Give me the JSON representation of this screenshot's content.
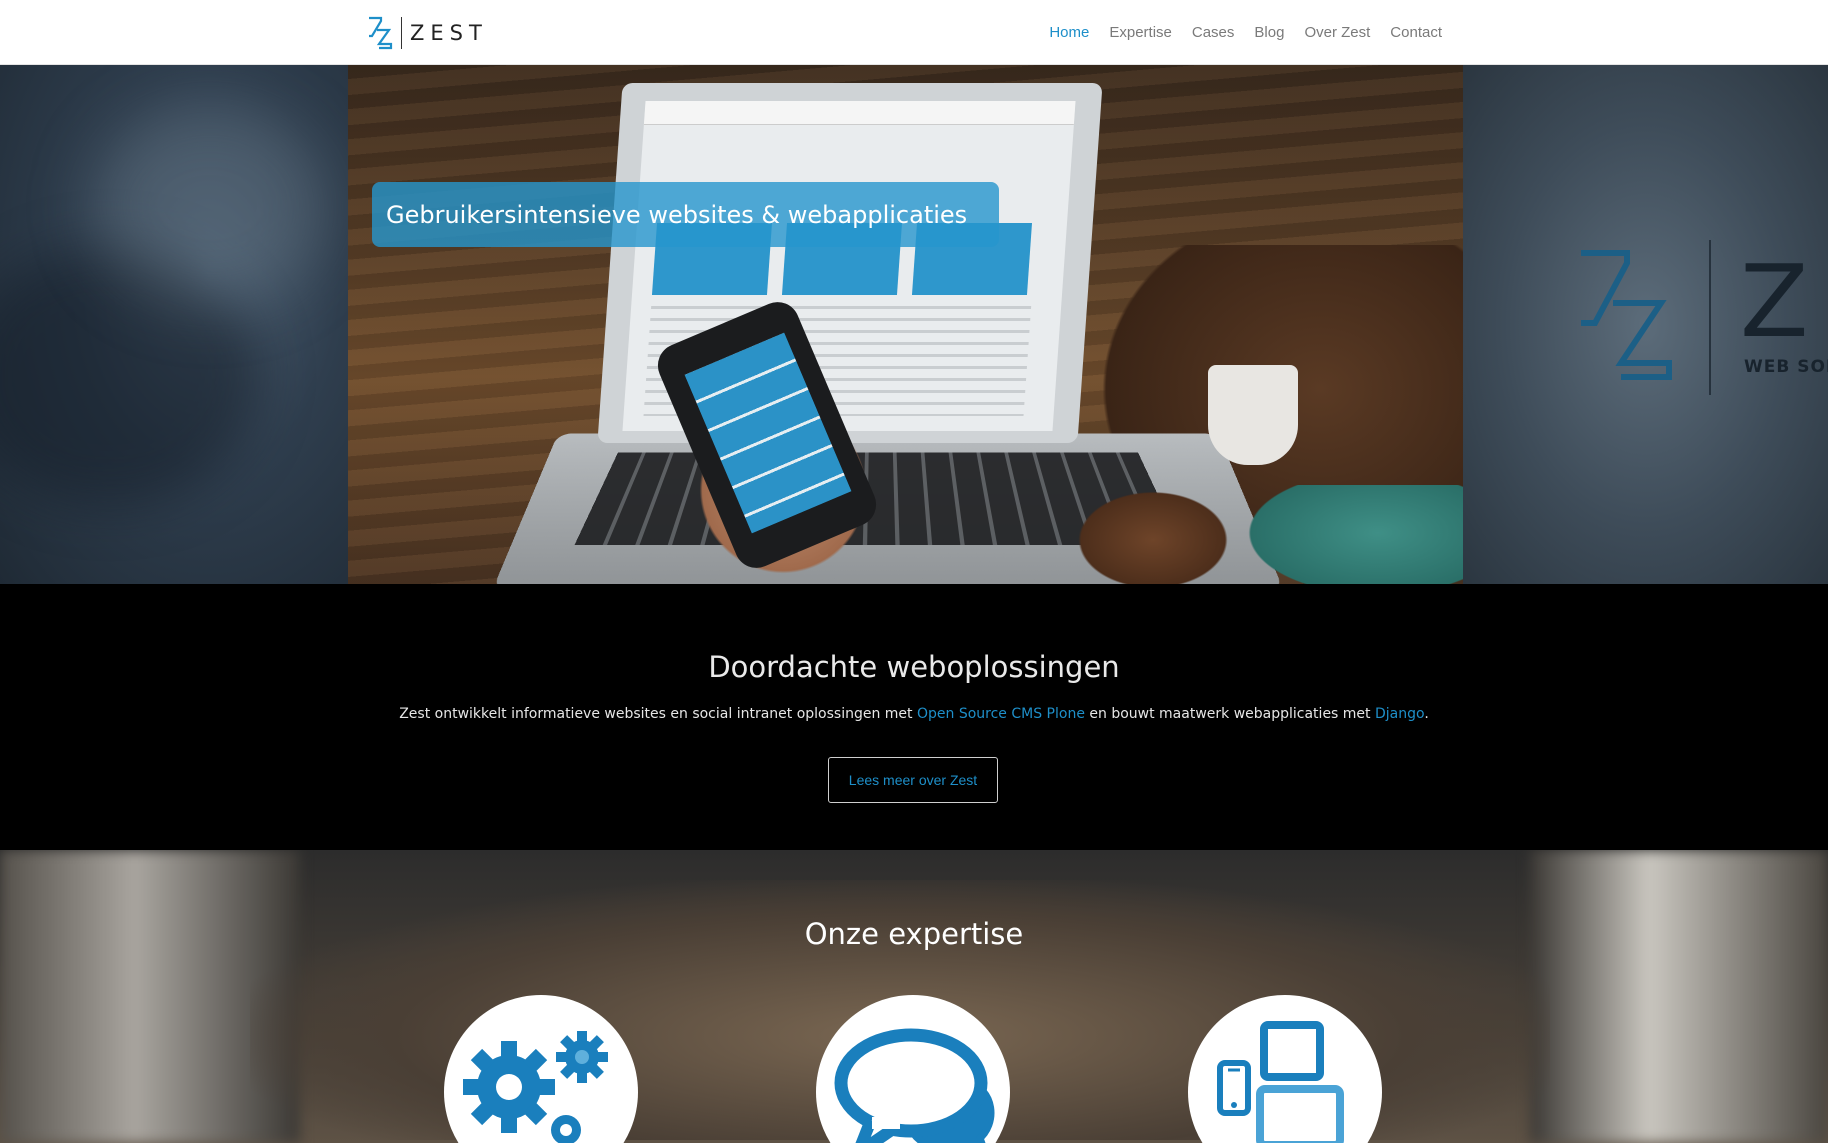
{
  "header": {
    "logo_text": "ZEST",
    "nav": [
      {
        "label": "Home",
        "active": true
      },
      {
        "label": "Expertise",
        "active": false
      },
      {
        "label": "Cases",
        "active": false
      },
      {
        "label": "Blog",
        "active": false
      },
      {
        "label": "Over Zest",
        "active": false
      },
      {
        "label": "Contact",
        "active": false
      }
    ]
  },
  "hero": {
    "caption": "Gebruikersintensieve websites & webapplicaties",
    "slides_total": 3,
    "active_slide": 2,
    "side_logo_letter": "Z",
    "side_logo_subtext": "WEB SOLU"
  },
  "intro": {
    "title": "Doordachte weboplossingen",
    "text_before": "Zest ontwikkelt informatieve websites en social intranet oplossingen met ",
    "link1": "Open Source CMS Plone",
    "text_middle": " en bouwt maatwerk webapplicaties met ",
    "link2": "Django",
    "text_after": ".",
    "button_label": "Lees meer over Zest"
  },
  "expertise": {
    "title": "Onze expertise",
    "items": [
      {
        "icon": "gears-icon"
      },
      {
        "icon": "chat-bubbles-icon"
      },
      {
        "icon": "devices-icon"
      }
    ]
  },
  "colors": {
    "accent": "#1e8fc9",
    "nav_text": "#7a7a7a",
    "icon_blue": "#1a7fbd"
  }
}
